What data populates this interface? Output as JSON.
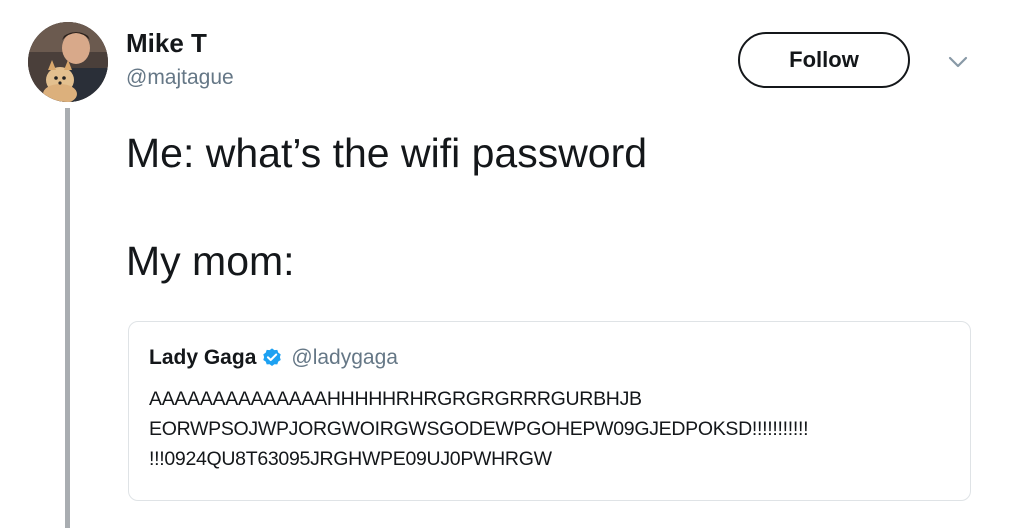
{
  "author": {
    "name": "Mike T",
    "handle": "@majtague"
  },
  "actions": {
    "follow_label": "Follow",
    "menu_icon": "chevron-down-icon"
  },
  "tweet": {
    "lines": [
      "Me: what’s the wifi password",
      "My mom:"
    ]
  },
  "quoted_tweet": {
    "name": "Lady Gaga",
    "verified": true,
    "handle": "@ladygaga",
    "text_lines": [
      "AAAAAAAAAAAAAAHHHHHRHRGRGRGRRRGURBHJB",
      "EORWPSOJWPJORGWOIRGWSGODEWPGOHEPW09GJEDPOKSD!!!!!!!!!!!",
      "!!!0924QU8T63095JRGHWPE09UJ0PWHRGW"
    ]
  },
  "colors": {
    "text": "#14171a",
    "secondary": "#657786",
    "verified": "#1da1f2",
    "thread_line": "#a9adb1",
    "card_border": "#dfe3e6"
  }
}
